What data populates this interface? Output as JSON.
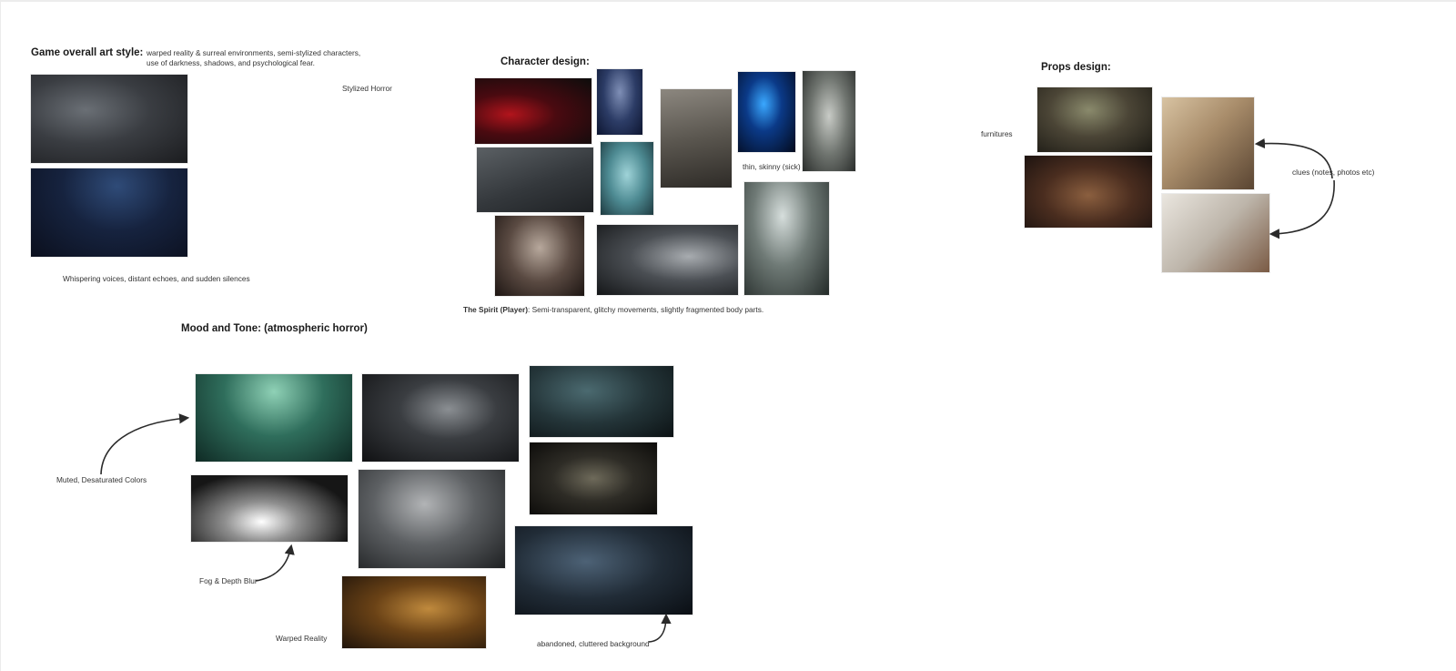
{
  "board": {
    "art_style": {
      "heading": "Game overall art style:",
      "description": "warped reality & surreal environments, semi-stylized characters, use of darkness, shadows, and psychological fear.",
      "label_stylized": "Stylized Horror",
      "label_audio": "Whispering voices, distant echoes, and sudden silences"
    },
    "character": {
      "heading": "Character design:",
      "label_thin": "thin, skinny (sick)",
      "spirit_name": "The Spirit (Player)",
      "spirit_desc": ": Semi-transparent, glitchy movements, slightly fragmented body parts."
    },
    "props": {
      "heading": "Props design:",
      "label_furniture": "furnitures",
      "label_clues": "clues (notes, photos etc)"
    },
    "mood": {
      "heading": "Mood and Tone: (atmospheric horror)",
      "label_muted": "Muted, Desaturated Colors",
      "label_fog": "Fog & Depth Blur",
      "label_warped": "Warped Reality",
      "label_abandoned": "abandoned, cluttered background"
    }
  },
  "colors": {
    "background": "#ffffff",
    "text": "#222222",
    "arrow": "#2a2a2a"
  }
}
